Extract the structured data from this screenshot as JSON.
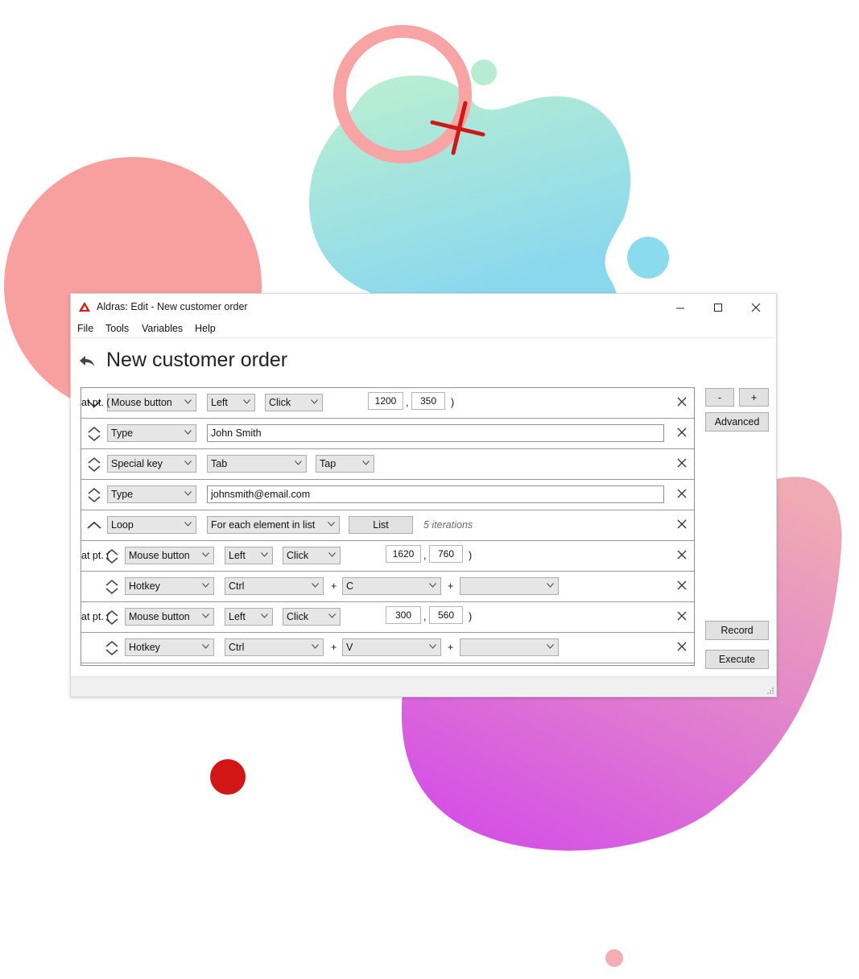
{
  "colors": {
    "coral": "#f8a0a0",
    "mint_top": "#b6efce",
    "mint_bottom": "#8cdced",
    "magenta": "#d655e4",
    "pink": "#f3a7b2",
    "red": "#d21515"
  },
  "window": {
    "title": "Aldras: Edit - New customer order",
    "app_icon": "aldras-logo-icon",
    "controls": [
      "minimize-icon",
      "maximize-icon",
      "close-icon"
    ]
  },
  "menu": [
    "File",
    "Tools",
    "Variables",
    "Help"
  ],
  "page": {
    "title": "New customer order",
    "back_icon": "back-arrow-icon"
  },
  "rows": [
    {
      "indent": 0,
      "handle": "collapse-chevron-icon",
      "action": "Mouse button",
      "f1": "Left",
      "f2": "Click",
      "at_label": "at pt. (",
      "x": "1200",
      "comma": ",",
      "y": "350",
      "close_paren": ")"
    },
    {
      "indent": 0,
      "handle": "reorder-icon",
      "action": "Type",
      "text": "John Smith"
    },
    {
      "indent": 0,
      "handle": "reorder-icon",
      "action": "Special key",
      "f1": "Tab",
      "f2": "Tap"
    },
    {
      "indent": 0,
      "handle": "reorder-icon",
      "action": "Type",
      "text": "johnsmith@email.com"
    },
    {
      "indent": 0,
      "handle": "expand-chevron-icon",
      "action": "Loop",
      "f1": "For each element in list",
      "button": "List",
      "note": "5 iterations"
    },
    {
      "indent": 1,
      "handle": "reorder-icon",
      "action": "Mouse button",
      "f1": "Left",
      "f2": "Click",
      "at_label": "at pt. (",
      "x": "1620",
      "comma": ",",
      "y": "760",
      "close_paren": ")"
    },
    {
      "indent": 1,
      "handle": "reorder-icon",
      "action": "Hotkey",
      "f1": "Ctrl",
      "plus1": "+",
      "f2": "C",
      "plus2": "+",
      "f3": ""
    },
    {
      "indent": 1,
      "handle": "reorder-icon",
      "action": "Mouse button",
      "f1": "Left",
      "f2": "Click",
      "at_label": "at pt. (",
      "x": "300",
      "comma": ",",
      "y": "560",
      "close_paren": ")"
    },
    {
      "indent": 1,
      "handle": "reorder-icon",
      "action": "Hotkey",
      "f1": "Ctrl",
      "plus1": "+",
      "f2": "V",
      "plus2": "+",
      "f3": ""
    }
  ],
  "side": {
    "minus": "-",
    "plus": "+",
    "advanced": "Advanced",
    "record": "Record",
    "execute": "Execute"
  }
}
